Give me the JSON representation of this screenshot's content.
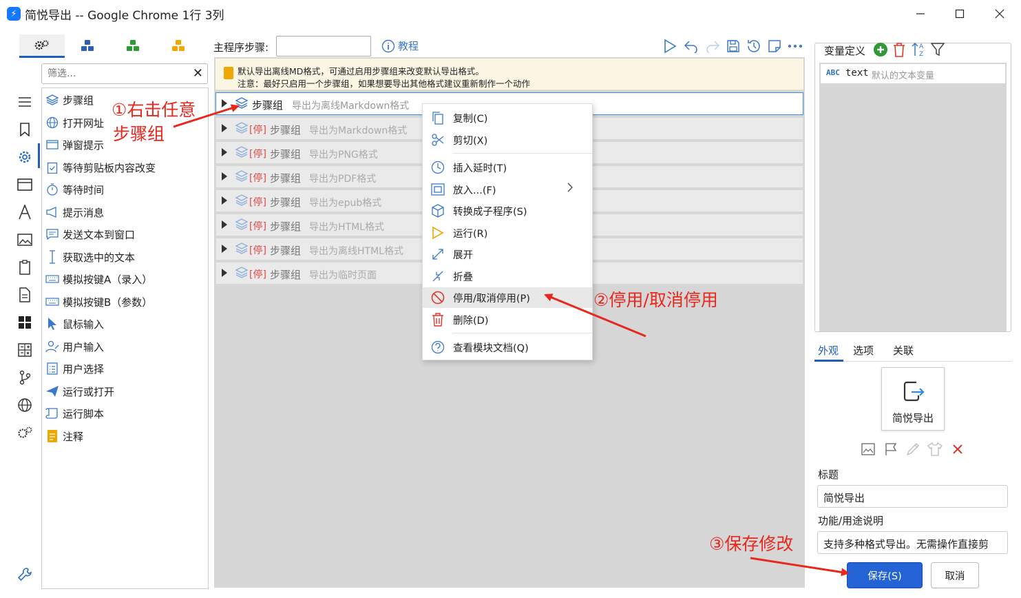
{
  "window": {
    "title": "简悦导出 -- Google Chrome 1行 3列",
    "app_icon": "⚡"
  },
  "left_panel": {
    "filter_placeholder": "筛选...",
    "actions": [
      {
        "label": "步骤组",
        "icon": "layers-icon"
      },
      {
        "label": "打开网址",
        "icon": "globe-icon"
      },
      {
        "label": "弹窗提示",
        "icon": "window-icon"
      },
      {
        "label": "等待剪贴板内容改变",
        "icon": "clipboard-check-icon"
      },
      {
        "label": "等待时间",
        "icon": "timer-icon"
      },
      {
        "label": "提示消息",
        "icon": "megaphone-icon"
      },
      {
        "label": "发送文本到窗口",
        "icon": "message-icon"
      },
      {
        "label": "获取选中的文本",
        "icon": "text-cursor-icon"
      },
      {
        "label": "模拟按键A（录入）",
        "icon": "keyboard-icon"
      },
      {
        "label": "模拟按键B（参数）",
        "icon": "keyboard-icon"
      },
      {
        "label": "鼠标输入",
        "icon": "cursor-icon"
      },
      {
        "label": "用户输入",
        "icon": "user-icon"
      },
      {
        "label": "用户选择",
        "icon": "checklist-icon"
      },
      {
        "label": "运行或打开",
        "icon": "paper-plane-icon"
      },
      {
        "label": "运行脚本",
        "icon": "scroll-icon"
      },
      {
        "label": "注释",
        "icon": "note-icon"
      }
    ]
  },
  "toolbar": {
    "steps_label": "主程序步骤:",
    "steps_value": "",
    "tutorial_label": "教程"
  },
  "notice": {
    "line1": "默认导出离线MD格式，可通过启用步骤组来改变默认导出格式。",
    "line2": "注意：最好只启用一个步骤组，如果想要导出其他格式建议重新制作一个动作"
  },
  "steps": [
    {
      "name": "步骤组",
      "tag": "",
      "desc": "导出为离线Markdown格式",
      "disabled": false
    },
    {
      "name": "步骤组",
      "tag": "[停]",
      "desc": "导出为Markdown格式",
      "disabled": true
    },
    {
      "name": "步骤组",
      "tag": "[停]",
      "desc": "导出为PNG格式",
      "disabled": true
    },
    {
      "name": "步骤组",
      "tag": "[停]",
      "desc": "导出为PDF格式",
      "disabled": true
    },
    {
      "name": "步骤组",
      "tag": "[停]",
      "desc": "导出为epub格式",
      "disabled": true
    },
    {
      "name": "步骤组",
      "tag": "[停]",
      "desc": "导出为HTML格式",
      "disabled": true
    },
    {
      "name": "步骤组",
      "tag": "[停]",
      "desc": "导出为离线HTML格式",
      "disabled": true
    },
    {
      "name": "步骤组",
      "tag": "[停]",
      "desc": "导出为临时页面",
      "disabled": true
    }
  ],
  "context_menu": {
    "items": [
      {
        "label": "复制(C)",
        "icon": "copy-icon"
      },
      {
        "label": "剪切(X)",
        "icon": "scissors-icon"
      },
      {
        "label": "插入延时(T)",
        "icon": "clock-icon"
      },
      {
        "label": "放入...(F)",
        "icon": "frame-icon",
        "submenu": true
      },
      {
        "label": "转换成子程序(S)",
        "icon": "cube-icon"
      },
      {
        "label": "运行(R)",
        "icon": "play-icon"
      },
      {
        "label": "展开",
        "icon": "expand-icon"
      },
      {
        "label": "折叠",
        "icon": "collapse-icon"
      },
      {
        "label": "停用/取消停用(P)",
        "icon": "ban-icon",
        "highlighted": true
      },
      {
        "label": "删除(D)",
        "icon": "trash-icon"
      },
      {
        "label": "查看模块文档(Q)",
        "icon": "help-icon"
      }
    ]
  },
  "variables": {
    "title": "变量定义",
    "items": [
      {
        "type": "ABC",
        "name": "text",
        "desc": "默认的文本变量"
      }
    ]
  },
  "properties": {
    "tabs": [
      "外观",
      "选项",
      "关联"
    ],
    "active_tab": "外观",
    "preview_name": "简悦导出",
    "title_label": "标题",
    "title_value": "简悦导出",
    "desc_label": "功能/用途说明",
    "desc_value": "支持多种格式导出。无需操作直接剪",
    "save_label": "保存(S)",
    "cancel_label": "取消"
  },
  "annotations": {
    "a1_line1": "①右击任意",
    "a1_line2": "步骤组",
    "a2": "②停用/取消停用",
    "a3": "③保存修改"
  },
  "colors": {
    "accent": "#2463d6",
    "annotation": "#e8271d",
    "disabled_tag": "#e04a4a",
    "notice_bg": "#fbf6e3"
  }
}
